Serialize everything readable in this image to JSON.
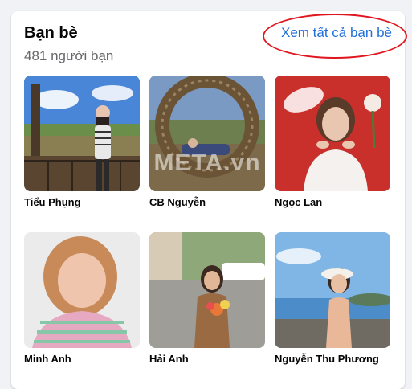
{
  "friends_section": {
    "title": "Bạn bè",
    "count_text": "481 người bạn",
    "see_all_label": "Xem tất cả bạn bè",
    "highlight_color": "#e0151d",
    "link_color": "#216fdb"
  },
  "friends": [
    {
      "name": "Tiểu Phụng"
    },
    {
      "name": "CB Nguyễn",
      "watermark": "META.vn"
    },
    {
      "name": "Ngọc Lan"
    },
    {
      "name": "Minh Anh"
    },
    {
      "name": "Hải Anh"
    },
    {
      "name": "Nguyễn Thu Phương"
    }
  ]
}
